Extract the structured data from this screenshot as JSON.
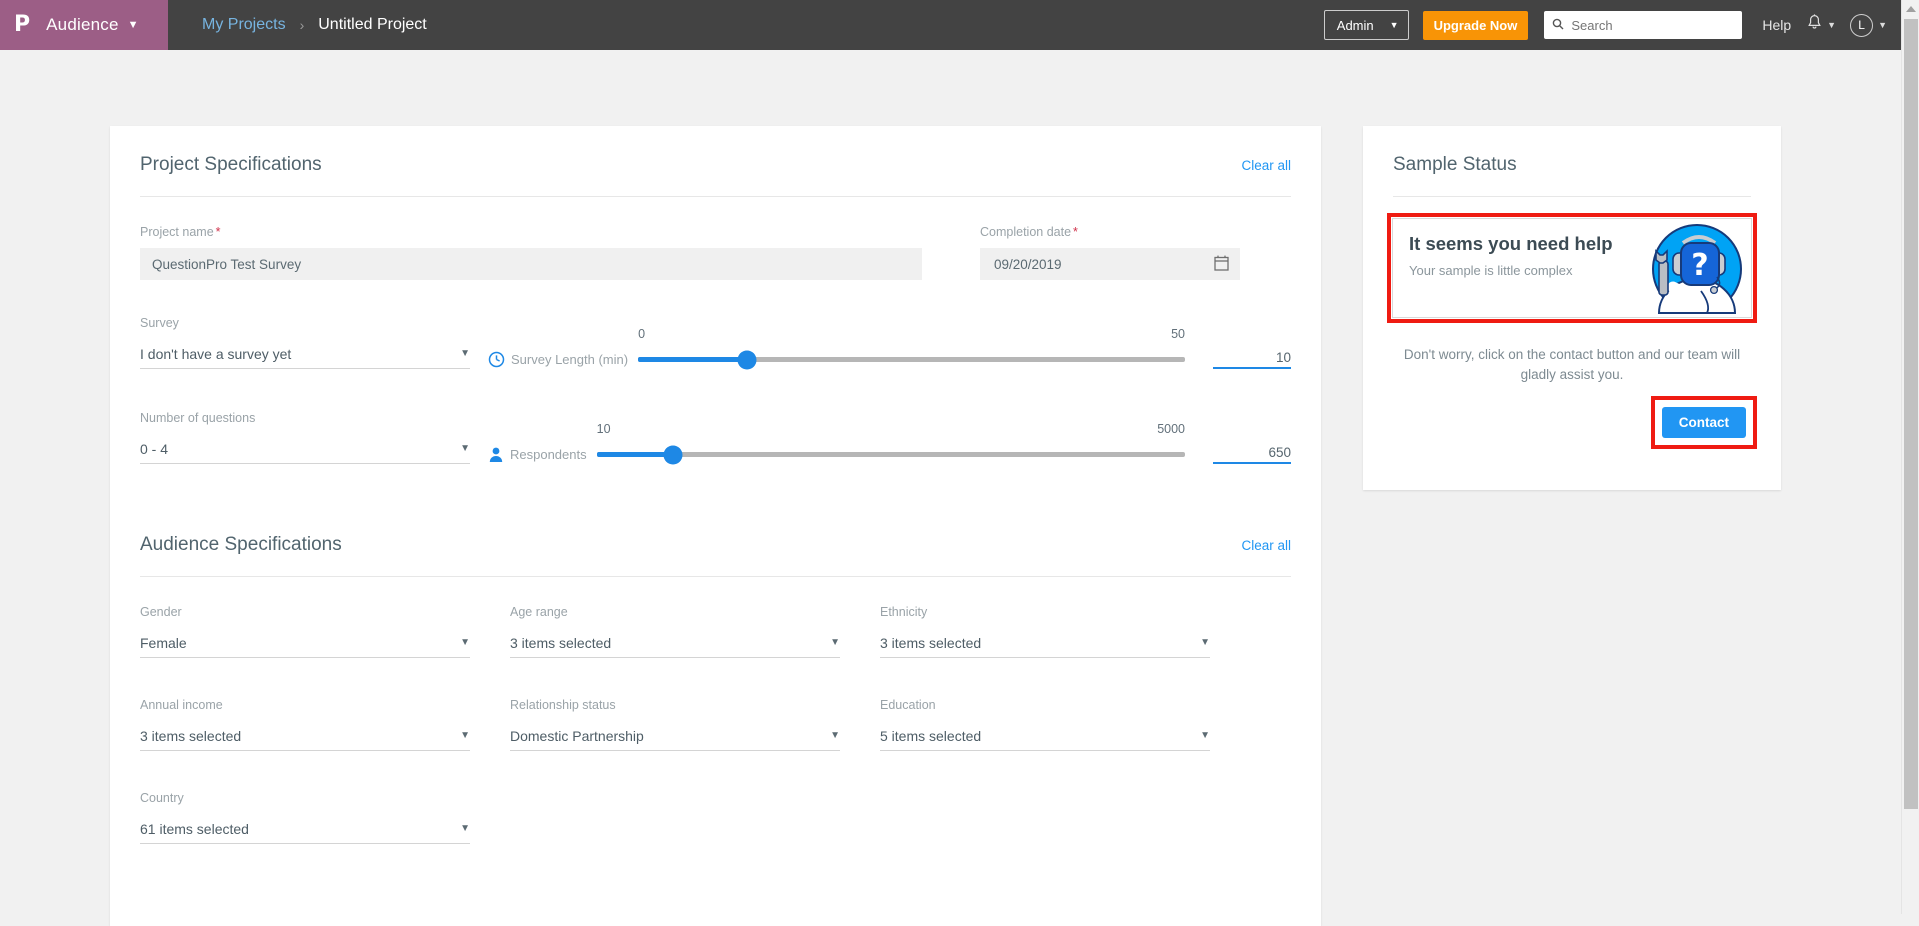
{
  "topbar": {
    "logo_glyph": "P",
    "brand_label": "Audience",
    "brand_caret": "▼",
    "breadcrumb": {
      "parent": "My Projects",
      "separator": "›",
      "current": "Untitled Project"
    },
    "admin_label": "Admin",
    "admin_caret": "▼",
    "upgrade_label": "Upgrade Now",
    "search_placeholder": "Search",
    "search_value": "",
    "search_icon": "search-icon",
    "help_label": "Help",
    "bell_caret": "▼",
    "avatar_initial": "L",
    "avatar_caret": "▼",
    "colors": {
      "bar": "#434343",
      "brand": "#9c5e86",
      "upgrade": "#f89406",
      "link": "#77b4e0"
    }
  },
  "project_spec": {
    "title": "Project Specifications",
    "clear_all": "Clear all",
    "project_name": {
      "label": "Project name",
      "required": "*",
      "value": "QuestionPro Test Survey"
    },
    "completion_date": {
      "label": "Completion date",
      "required": "*",
      "value": "09/20/2019",
      "icon": "calendar-icon"
    },
    "survey": {
      "label": "Survey",
      "value": "I don't have a survey yet",
      "caret": "▼"
    },
    "survey_length": {
      "label": "Survey Length (min)",
      "icon": "clock-icon",
      "min": "0",
      "max": "50",
      "value": "10",
      "percent": 20
    },
    "number_of_questions": {
      "label": "Number of questions",
      "value": "0 - 4",
      "caret": "▼"
    },
    "respondents": {
      "label": "Respondents",
      "icon": "person-icon",
      "min": "10",
      "max": "5000",
      "value": "650",
      "percent": 13
    }
  },
  "audience_spec": {
    "title": "Audience Specifications",
    "clear_all": "Clear all",
    "fields": [
      {
        "label": "Gender",
        "value": "Female",
        "caret": "▼"
      },
      {
        "label": "Age range",
        "value": "3 items selected",
        "caret": "▼"
      },
      {
        "label": "Ethnicity",
        "value": "3 items selected",
        "caret": "▼"
      },
      {
        "label": "Annual income",
        "value": "3 items selected",
        "caret": "▼"
      },
      {
        "label": "Relationship status",
        "value": "Domestic Partnership",
        "caret": "▼"
      },
      {
        "label": "Education",
        "value": "5 items selected",
        "caret": "▼"
      },
      {
        "label": "Country",
        "value": "61 items selected",
        "caret": "▼"
      }
    ]
  },
  "sample_status": {
    "title": "Sample Status",
    "help_title": "It seems you need help",
    "help_sub": "Your sample is little complex",
    "mascot_icon": "support-robot-icon",
    "note": "Don't worry, click on the contact button and our team will gladly assist you.",
    "contact_label": "Contact",
    "highlight_color": "#ef1b12"
  },
  "scrollbar": {
    "up_arrow": "scroll-up-arrow"
  }
}
